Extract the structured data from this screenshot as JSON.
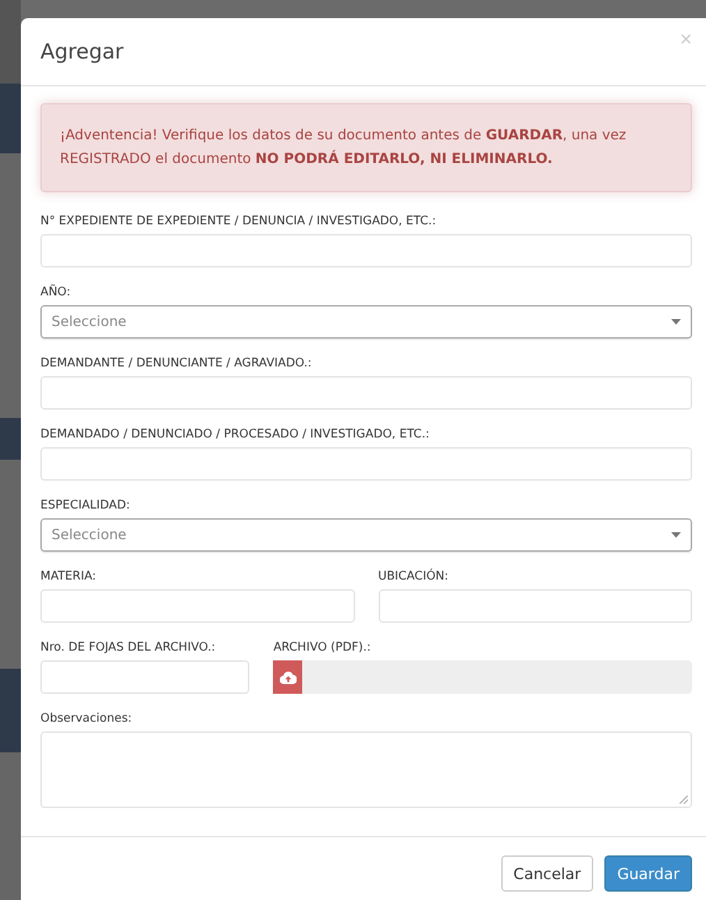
{
  "modal": {
    "title": "Agregar",
    "close": "×"
  },
  "alert": "¡Adventencia! Verifique los datos de su documento antes de **GUARDAR**, una vez REGISTRADO el documento **NO PODRÁ EDITARLO, NI ELIMINARLO.**",
  "rows": [
    [
      {
        "kind": "text",
        "label": "N° EXPEDIENTE DE EXPEDIENTE / DENUNCIA / INVESTIGADO, ETC.:"
      }
    ],
    [
      {
        "kind": "select",
        "label": "AÑO:",
        "placeholder": "Seleccione"
      }
    ],
    [
      {
        "kind": "text",
        "label": "DEMANDANTE / DENUNCIANTE / AGRAVIADO.:"
      }
    ],
    [
      {
        "kind": "text",
        "label": "DEMANDADO / DENUNCIADO / PROCESADO / INVESTIGADO, ETC.:"
      }
    ],
    [
      {
        "kind": "select",
        "label": "ESPECIALIDAD:",
        "placeholder": "Seleccione"
      }
    ],
    [
      {
        "kind": "text",
        "label": "MATERIA:"
      },
      {
        "kind": "text",
        "label": "UBICACIÓN:"
      }
    ],
    [
      {
        "kind": "text",
        "label": "Nro. DE FOJAS DEL ARCHIVO.:"
      },
      {
        "kind": "file",
        "label": "ARCHIVO (PDF).:"
      }
    ],
    [
      {
        "kind": "textarea",
        "label": "Observaciones:"
      }
    ]
  ],
  "buttons": [
    {
      "kind": "default",
      "label": "Cancelar"
    },
    {
      "kind": "primary",
      "label": "Guardar"
    }
  ]
}
